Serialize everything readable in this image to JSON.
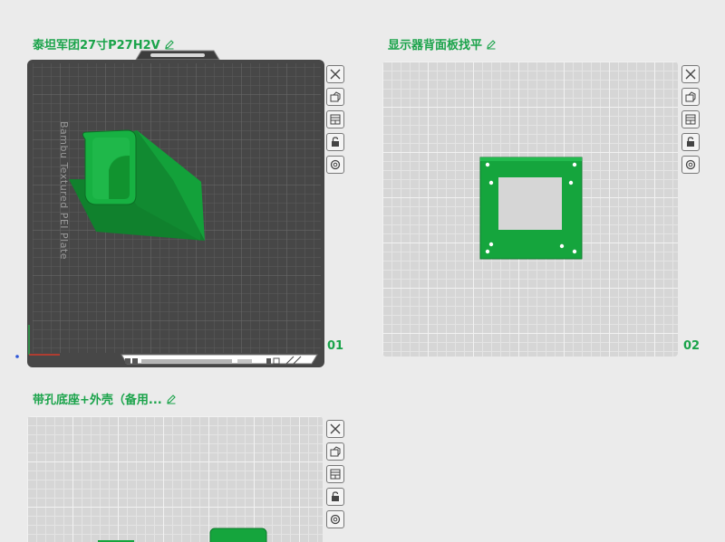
{
  "plates": [
    {
      "title": "泰坦军团27寸P27H2V",
      "number": "01",
      "bed_label": "Bambu Textured PEI Plate"
    },
    {
      "title": "显示器背面板找平",
      "number": "02"
    },
    {
      "title": "带孔底座+外壳（备用..."
    }
  ],
  "toolbar_icons": [
    "close-icon",
    "orient-icon",
    "arrange-icon",
    "lock-icon",
    "settings-icon"
  ],
  "colors": {
    "accent": "#1aa34a",
    "model_green": "#13a13a",
    "dark_bed": "#4a4a4a",
    "light_bed": "#d6d6d6"
  }
}
